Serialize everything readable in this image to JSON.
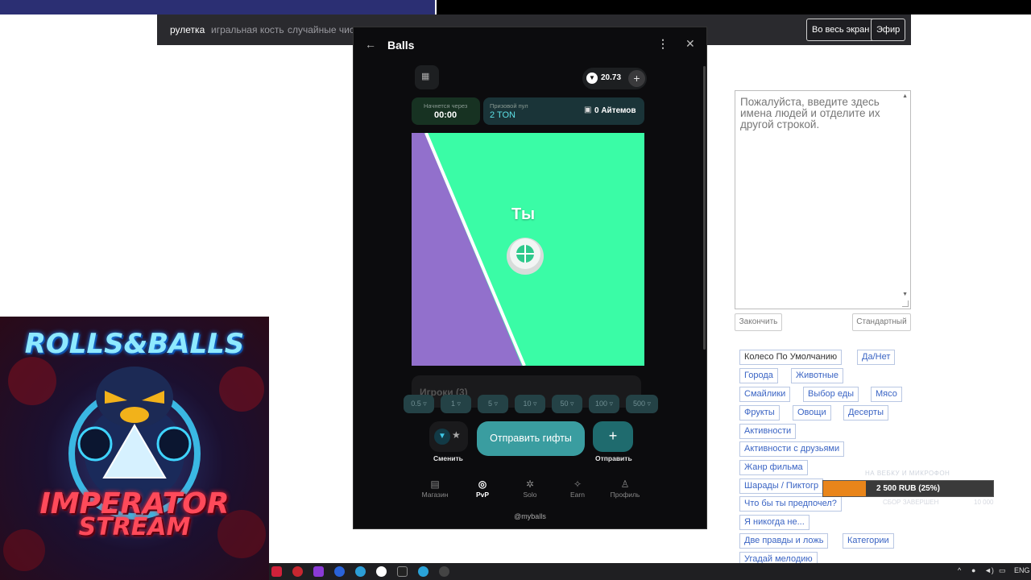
{
  "site_nav": {
    "items": [
      "рулетка",
      "игральная кость",
      "случайные числ"
    ],
    "fullscreen_label": "Во весь экран",
    "broadcast_label": "Эфир"
  },
  "names_input": {
    "placeholder": "Пожалуйста, введите здесь имена людей и отделите их другой строкой.",
    "finish_label": "Закончить",
    "standard_label": "Стандартный"
  },
  "categories": [
    "Колесо По Умолчанию",
    "Да/Нет",
    "Города",
    "Животные",
    "Смайлики",
    "Выбор еды",
    "Мясо",
    "Фрукты",
    "Овощи",
    "Десерты",
    "Активности",
    "Активности с друзьями",
    "Жанр фильма",
    "Шарады / Пиктогр",
    "Что бы ты предпочел?",
    "Я никогда не...",
    "Две правды и ложь",
    "Категории",
    "Угадай мелодию"
  ],
  "donation": {
    "goal_title": "НА ВЕБКУ И МИКРОФОН",
    "amount_label": "2 500 RUB (25%)",
    "progress_fraction": 0.25,
    "status_text": "СБОР ЗАВЕРШЕН",
    "goal_amount": "10 000"
  },
  "logo": {
    "line1": "ROLLS&BALLS",
    "line2": "IMPERATOR",
    "line3": "STREAM"
  },
  "app": {
    "title": "Balls",
    "balance": "20.73",
    "starts_in_label": "Начнется через",
    "timer": "00:00",
    "prize_pool_label": "Призовой пул",
    "prize_pool_value": "2 TON",
    "items_label": "0 Айтемов",
    "player_label": "Ты",
    "players_title": "Игроки (3)",
    "bets": [
      "0.5",
      "1",
      "5",
      "10",
      "50",
      "100",
      "500"
    ],
    "switch_label": "Сменить",
    "send_gifts_label": "Отправить гифты",
    "send_label": "Отправить",
    "tabs": [
      "Магазин",
      "PvP",
      "Solo",
      "Earn",
      "Профиль"
    ],
    "active_tab": "PvP",
    "footer": "@myballs"
  },
  "taskbar": {
    "language": "ENG"
  },
  "colors": {
    "field_green": "#3afca6",
    "field_purple": "#9270cc",
    "accent_teal": "#3a9da0",
    "donation_orange": "#e9851a"
  }
}
